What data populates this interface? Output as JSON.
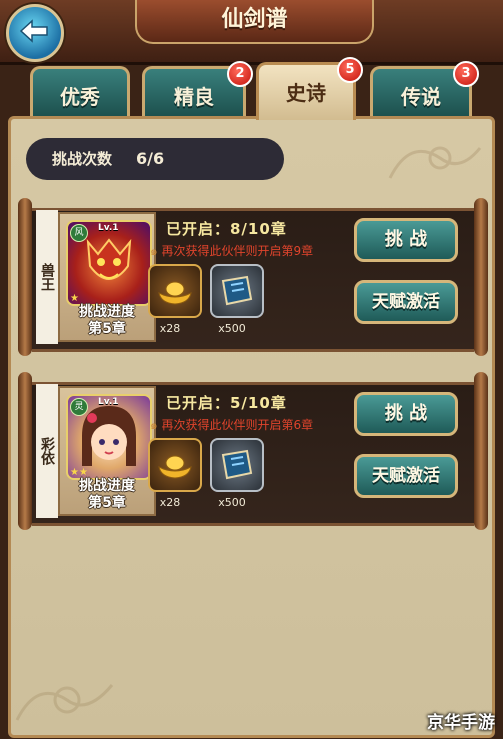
{
  "header": {
    "title": "仙剑谱"
  },
  "tabs": [
    {
      "label": "优秀",
      "badge": ""
    },
    {
      "label": "精良",
      "badge": "2"
    },
    {
      "label": "史诗",
      "badge": "5"
    },
    {
      "label": "传说",
      "badge": "3"
    }
  ],
  "challenge_count": {
    "label": "挑战次数",
    "value": "6/6"
  },
  "cards": [
    {
      "side_name": "兽王",
      "level": "Lv.1",
      "element": "风",
      "stars": "★",
      "progress_label": "挑战进度",
      "progress_chapter": "第5章",
      "opened": "已开启：8/10章",
      "hint": "再次获得此伙伴则开启第9章",
      "items": [
        {
          "icon": "gold-ingot-icon",
          "count": "x28"
        },
        {
          "icon": "skill-book-icon",
          "count": "x500"
        }
      ],
      "challenge_button": "挑 战",
      "talent_button": "天赋激活"
    },
    {
      "side_name": "彩依",
      "level": "Lv.1",
      "element": "灵",
      "stars": "★★",
      "progress_label": "挑战进度",
      "progress_chapter": "第5章",
      "opened": "已开启：5/10章",
      "hint": "再次获得此伙伴则开启第6章",
      "items": [
        {
          "icon": "gold-ingot-icon",
          "count": "x28"
        },
        {
          "icon": "skill-book-icon",
          "count": "x500"
        }
      ],
      "challenge_button": "挑 战",
      "talent_button": "天赋激活"
    }
  ],
  "watermark": "京华手游"
}
